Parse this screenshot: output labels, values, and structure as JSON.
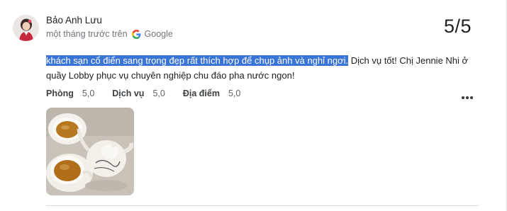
{
  "review": {
    "reviewer_name": "Bảo Anh Lưu",
    "time_ago": "một tháng trước trên",
    "source": "Google",
    "score": "5/5",
    "text_highlighted": "khách sạn cổ điển sang trọng đẹp rất thích hợp để chụp ảnh và nghỉ ngơi.",
    "text_rest": " Dịch vụ tốt! Chị Jennie Nhi ở quầy Lobby phục vụ chuyên nghiệp chu đáo pha nước ngon!",
    "ratings": [
      {
        "category": "Phòng",
        "value": "5,0"
      },
      {
        "category": "Dịch vụ",
        "value": "5,0"
      },
      {
        "category": "Địa điểm",
        "value": "5,0"
      }
    ]
  },
  "icons": {
    "google": "google-g-icon",
    "more": "more-vert-dots-icon",
    "avatar": "reviewer-avatar-photo"
  },
  "colors": {
    "highlight": "#3a74d6",
    "score_text": "#202124",
    "meta_text": "#70757a"
  }
}
